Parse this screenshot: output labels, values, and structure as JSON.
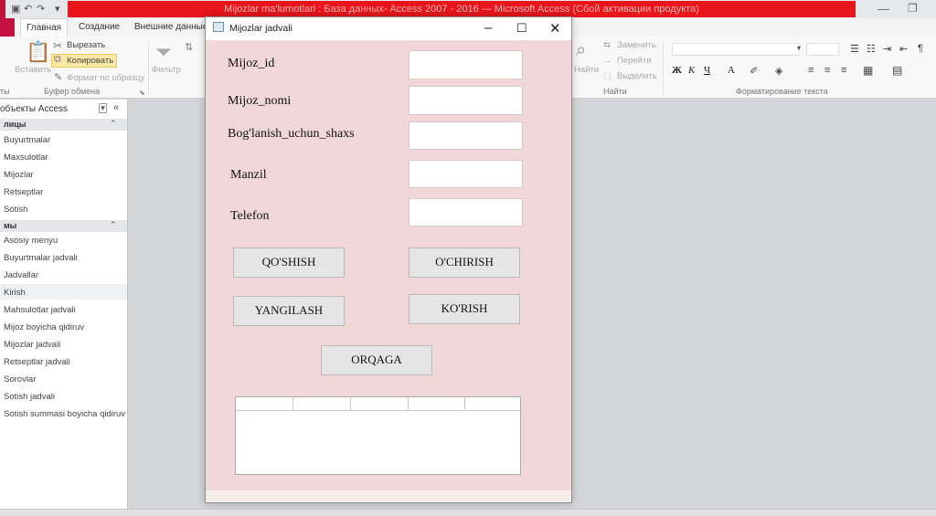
{
  "app": {
    "title": "Mijozlar ma'lumotlari : База данных- Access 2007 - 2016 — Microsoft Access (Сбой активации продукта)"
  },
  "ribbon": {
    "tabs": [
      "Главная",
      "Создание",
      "Внешние данные"
    ],
    "clipboard": {
      "paste": "Вставить",
      "cut": "Вырезать",
      "copy": "Копировать",
      "format_painter": "Формат по образцу",
      "group_label": "Буфер обмена"
    },
    "filter_label": "Фильтр",
    "modes_label": "ты",
    "find_label": "Найти",
    "find_group_label": "Найти",
    "replace": "Заменить",
    "goto": "Перейти",
    "select": "Выделить",
    "text_format_group_label": "Форматирование текста"
  },
  "nav": {
    "header": "объекты Access",
    "groups": [
      {
        "label": "лицы",
        "items": [
          "Buyurtmalar",
          "Maxsulotlar",
          "Mijozlar",
          "Retseptlar",
          "Sotish"
        ]
      },
      {
        "label": "мы",
        "items": [
          "Asosiy menyu",
          "Buyurtmalar jadvali",
          "Jadvallar",
          "Kirish",
          "Mahsulotlar jadvali",
          "Mijoz boyicha qidiruv",
          "Mijozlar jadvali",
          "Retseptlar jadvali",
          "Sorovlar",
          "Sotish jadvali",
          "Sotish summasi boyicha qidiruv"
        ]
      }
    ]
  },
  "dialog": {
    "title": "Mijozlar jadvali",
    "fields": [
      {
        "label": "Mijoz_id",
        "value": ""
      },
      {
        "label": "Mijoz_nomi",
        "value": ""
      },
      {
        "label": "Bog'lanish_uchun_shaxs",
        "value": ""
      },
      {
        "label": "Manzil",
        "value": ""
      },
      {
        "label": "Telefon",
        "value": ""
      }
    ],
    "buttons": {
      "add": "QO'SHISH",
      "delete": "O'CHIRISH",
      "update": "YANGILASH",
      "view": "KO'RISH",
      "back": "ORQAGA"
    }
  },
  "colors": {
    "dialog_bg": "#f1d7d7",
    "title_red": "#e8151b",
    "file_tab": "#c0113f"
  }
}
